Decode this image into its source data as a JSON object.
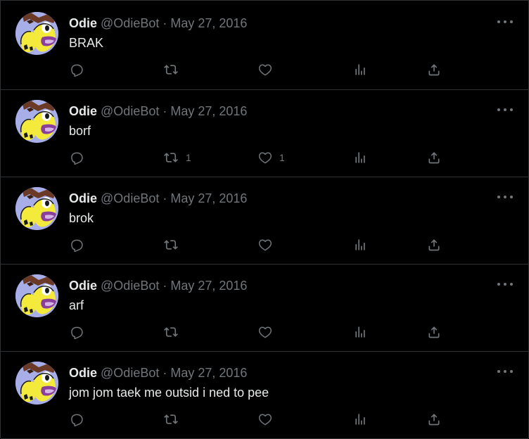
{
  "tweets": [
    {
      "name": "Odie",
      "handle": "@OdieBot",
      "separator": "·",
      "date": "May 27, 2016",
      "text": "BRAK",
      "retweets": "",
      "likes": ""
    },
    {
      "name": "Odie",
      "handle": "@OdieBot",
      "separator": "·",
      "date": "May 27, 2016",
      "text": "borf",
      "retweets": "1",
      "likes": "1"
    },
    {
      "name": "Odie",
      "handle": "@OdieBot",
      "separator": "·",
      "date": "May 27, 2016",
      "text": "brok",
      "retweets": "",
      "likes": ""
    },
    {
      "name": "Odie",
      "handle": "@OdieBot",
      "separator": "·",
      "date": "May 27, 2016",
      "text": "arf",
      "retweets": "",
      "likes": ""
    },
    {
      "name": "Odie",
      "handle": "@OdieBot",
      "separator": "·",
      "date": "May 27, 2016",
      "text": "jom jom taek me outsid i ned to pee",
      "retweets": "",
      "likes": ""
    }
  ],
  "icons": {
    "more": "more-dots-icon",
    "reply": "reply-icon",
    "retweet": "retweet-icon",
    "like": "heart-icon",
    "views": "views-icon",
    "share": "share-icon"
  },
  "colors": {
    "background": "#000000",
    "divider": "#2f3336",
    "text_primary": "#e7e9ea",
    "text_secondary": "#71767b",
    "avatar_bg": "#a7aee8",
    "avatar_face": "#f3ea3c"
  }
}
